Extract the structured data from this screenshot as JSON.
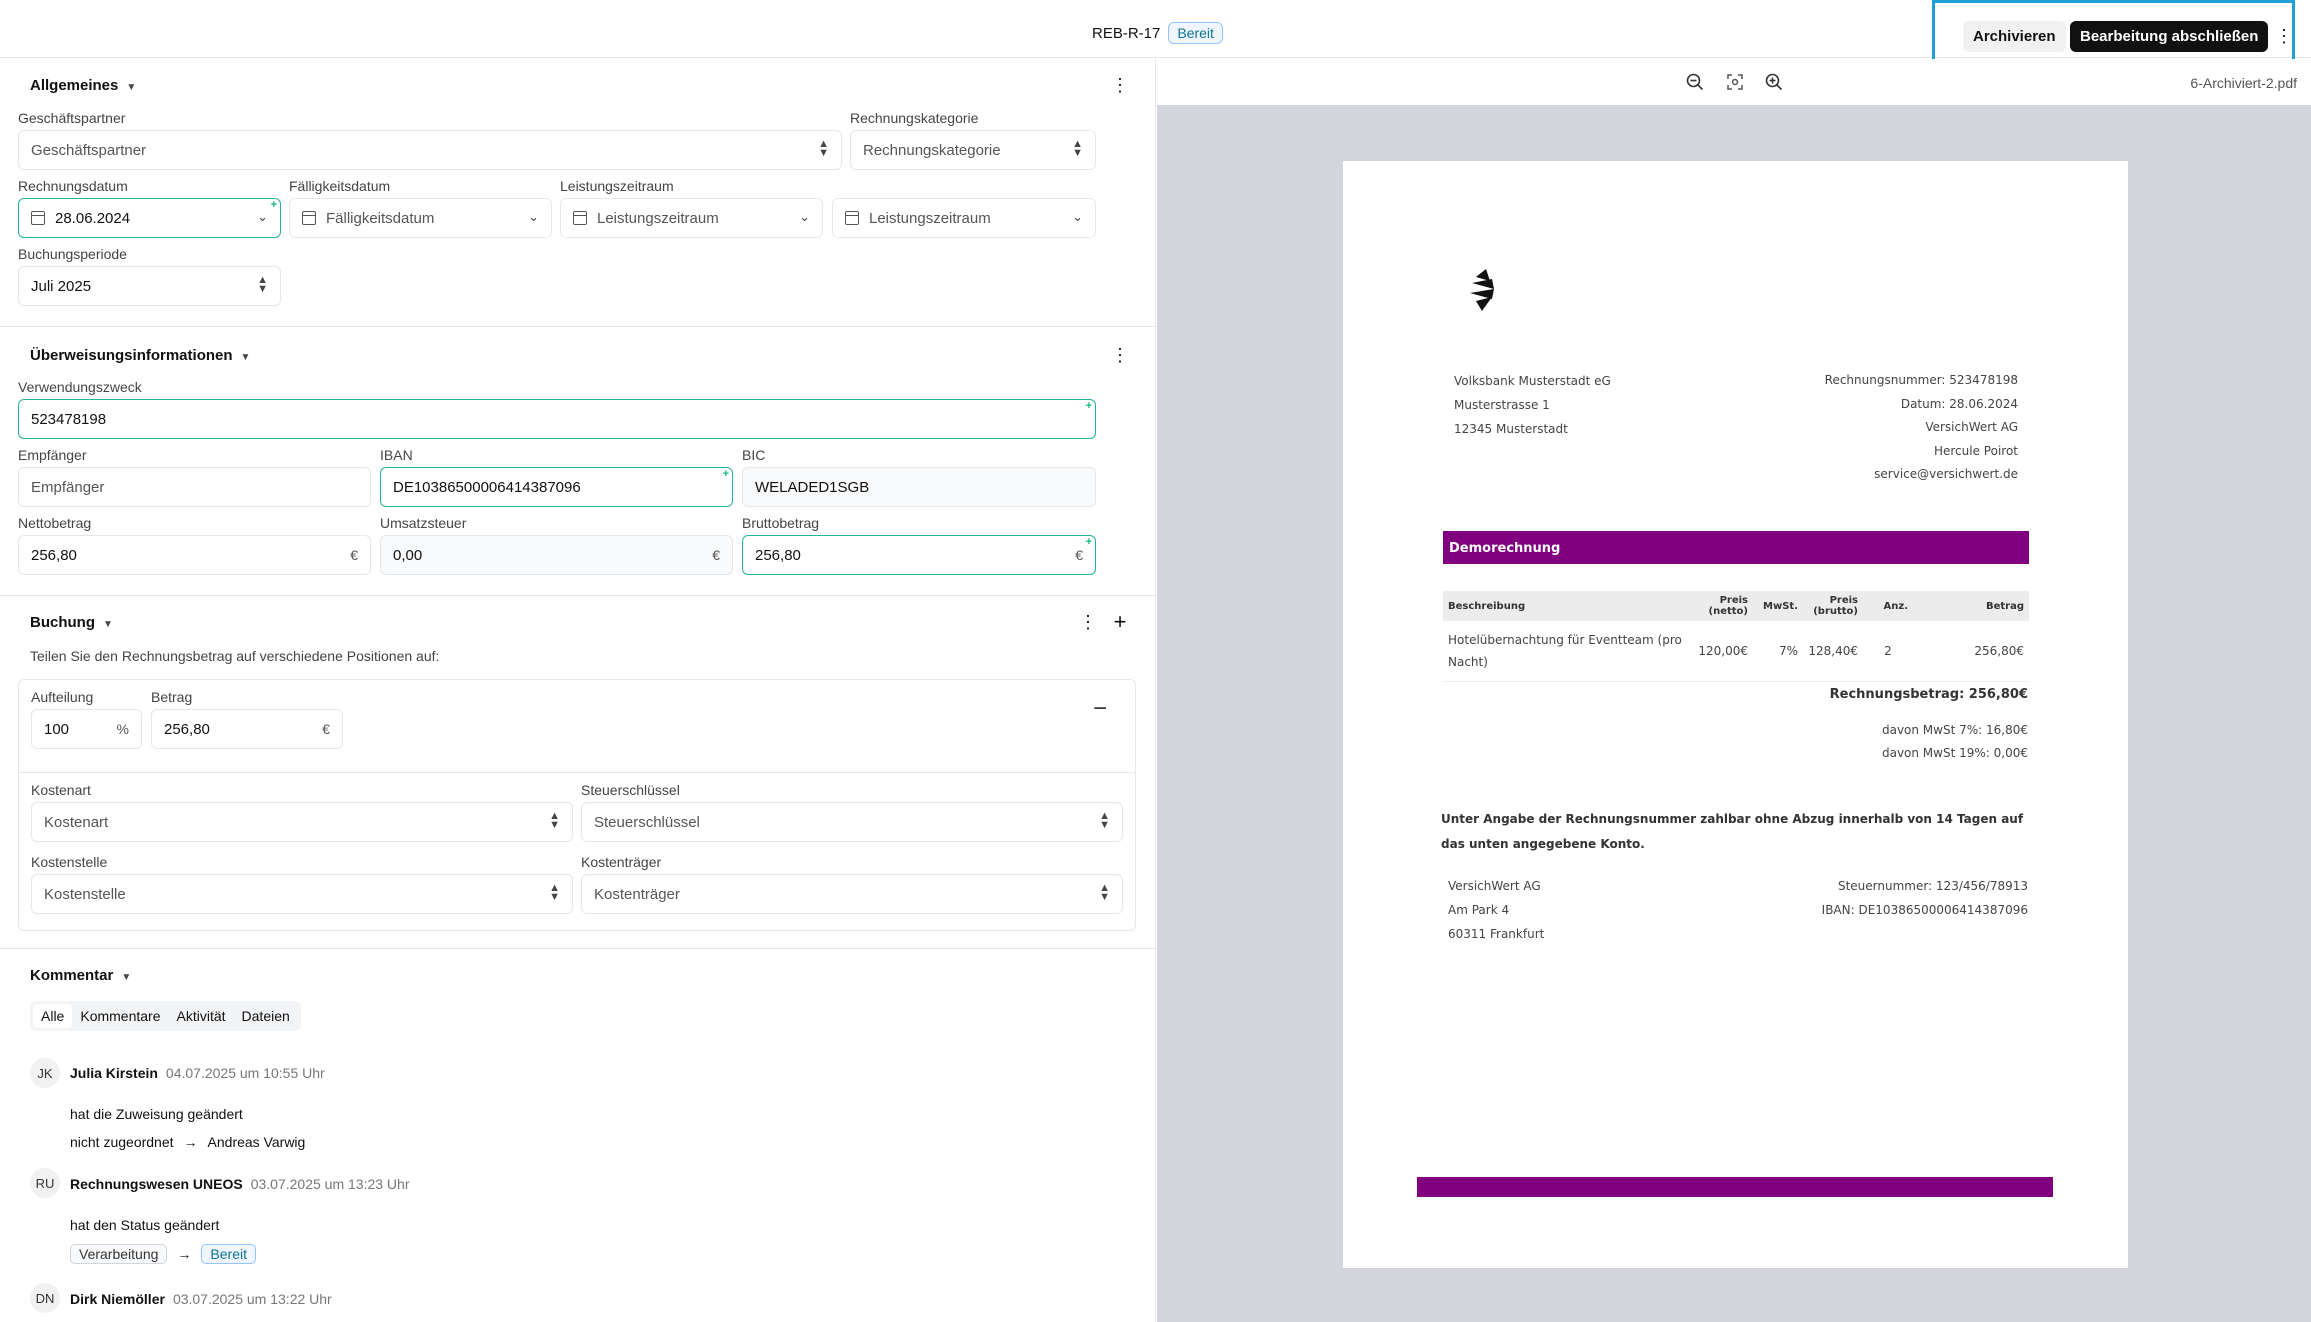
{
  "header": {
    "doc_id": "REB-R-17",
    "status": "Bereit",
    "archive_label": "Archivieren",
    "finish_label": "Bearbeitung abschließen",
    "more": "⋮"
  },
  "general": {
    "title": "Allgemeines",
    "partner_label": "Geschäftspartner",
    "partner_placeholder": "Geschäftspartner",
    "category_label": "Rechnungskategorie",
    "category_placeholder": "Rechnungskategorie",
    "invoice_date_label": "Rechnungsdatum",
    "invoice_date_value": "28.06.2024",
    "due_date_label": "Fälligkeitsdatum",
    "due_date_placeholder": "Fälligkeitsdatum",
    "service_period_label": "Leistungszeitraum",
    "service_period_from": "Leistungszeitraum",
    "service_period_to": "Leistungszeitraum",
    "booking_period_label": "Buchungsperiode",
    "booking_period_value": "Juli 2025"
  },
  "transfer": {
    "title": "Überweisungsinformationen",
    "purpose_label": "Verwendungszweck",
    "purpose_value": "523478198",
    "recipient_label": "Empfänger",
    "recipient_placeholder": "Empfänger",
    "iban_label": "IBAN",
    "iban_value": "DE10386500006414387096",
    "bic_label": "BIC",
    "bic_value": "WELADED1SGB",
    "net_label": "Nettobetrag",
    "net_value": "256,80",
    "vat_label": "Umsatzsteuer",
    "vat_value": "0,00",
    "gross_label": "Bruttobetrag",
    "gross_value": "256,80",
    "currency": "€"
  },
  "booking": {
    "title": "Buchung",
    "hint": "Teilen Sie den Rechnungsbetrag auf verschiedene Positionen auf:",
    "split_label": "Aufteilung",
    "split_value": "100",
    "percent": "%",
    "amount_label": "Betrag",
    "amount_value": "256,80",
    "currency": "€",
    "cost_type_label": "Kostenart",
    "cost_type_placeholder": "Kostenart",
    "tax_key_label": "Steuerschlüssel",
    "tax_key_placeholder": "Steuerschlüssel",
    "cost_center_label": "Kostenstelle",
    "cost_center_placeholder": "Kostenstelle",
    "cost_unit_label": "Kostenträger",
    "cost_unit_placeholder": "Kostenträger"
  },
  "comments": {
    "title": "Kommentar",
    "tabs": [
      "Alle",
      "Kommentare",
      "Aktivität",
      "Dateien"
    ],
    "entries": [
      {
        "initials": "JK",
        "name": "Julia Kirstein",
        "time": "04.07.2025 um 10:55 Uhr",
        "action": "hat die Zuweisung geändert",
        "from": "nicht zugeordnet",
        "to": "Andreas Varwig"
      },
      {
        "initials": "RU",
        "name": "Rechnungswesen UNEOS",
        "time": "03.07.2025 um 13:23 Uhr",
        "action": "hat den Status geändert",
        "from": "Verarbeitung",
        "to": "Bereit"
      },
      {
        "initials": "DN",
        "name": "Dirk Niemöller",
        "time": "03.07.2025 um 13:22 Uhr"
      }
    ]
  },
  "viewer": {
    "file_name": "6-Archiviert-2.pdf",
    "zoom_out": "−",
    "zoom_in": "+"
  },
  "invoice": {
    "sender": [
      "Volksbank Musterstadt eG",
      "Musterstrasse 1",
      "12345 Musterstadt"
    ],
    "meta": [
      "Rechnungsnummer: 523478198",
      "Datum: 28.06.2024",
      "VersichWert AG",
      "Hercule Poirot",
      "service@versichwert.de"
    ],
    "banner": "Demorechnung",
    "columns": [
      "Beschreibung",
      "Preis (netto)",
      "MwSt.",
      "Preis (brutto)",
      "Anz.",
      "Betrag"
    ],
    "row": [
      "Hotelübernachtung für Eventteam (pro Nacht)",
      "120,00€",
      "7%",
      "128,40€",
      "2",
      "256,80€"
    ],
    "total": "Rechnungsbetrag: 256,80€",
    "vat7": "davon MwSt 7%: 16,80€",
    "vat19": "davon MwSt 19%: 0,00€",
    "payment_note_1": "Unter Angabe der Rechnungsnummer zahlbar ohne Abzug innerhalb von 14 Tagen auf",
    "payment_note_2": "das unten angegebene Konto.",
    "footer_left": [
      "VersichWert AG",
      "Am Park 4",
      "60311 Frankfurt"
    ],
    "footer_right": [
      "Steuernummer: 123/456/78913",
      "IBAN: DE10386500006414387096"
    ]
  }
}
